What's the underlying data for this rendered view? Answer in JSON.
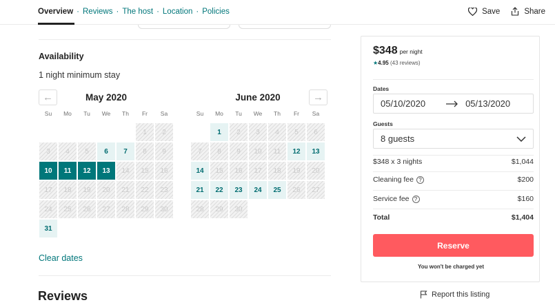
{
  "nav": {
    "links": [
      "Overview",
      "Reviews",
      "The host",
      "Location",
      "Policies"
    ],
    "separator": "·",
    "save_label": "Save",
    "share_label": "Share"
  },
  "availability": {
    "title": "Availability",
    "min_stay": "1 night minimum stay",
    "prev_icon": "←",
    "next_icon": "→",
    "clear_dates": "Clear dates",
    "months": [
      {
        "title": "May 2020",
        "dows": [
          "Su",
          "Mo",
          "Tu",
          "We",
          "Th",
          "Fr",
          "Sa"
        ],
        "offset": 5,
        "days": 31,
        "available": [
          6,
          7,
          31
        ],
        "selected": [
          10,
          11,
          12,
          13
        ]
      },
      {
        "title": "June 2020",
        "dows": [
          "Su",
          "Mo",
          "Tu",
          "We",
          "Th",
          "Fr",
          "Sa"
        ],
        "offset": 1,
        "days": 30,
        "available": [
          1,
          12,
          13,
          14,
          21,
          22,
          23,
          24,
          25
        ],
        "selected": []
      }
    ]
  },
  "reviews_heading": "Reviews",
  "booking": {
    "price": "$348",
    "price_unit": "per night",
    "rating_star": "★",
    "rating": "4.95",
    "reviews_count": "(43 reviews)",
    "dates_label": "Dates",
    "checkin": "05/10/2020",
    "checkout": "05/13/2020",
    "guests_label": "Guests",
    "guests": "8 guests",
    "nights_label": "$348 x 3 nights",
    "nights_value": "$1,044",
    "cleaning_label": "Cleaning fee",
    "cleaning_value": "$200",
    "service_label": "Service fee",
    "service_value": "$160",
    "total_label": "Total",
    "total_value": "$1,404",
    "help_icon": "?",
    "reserve_label": "Reserve",
    "no_charge": "You won't be charged yet"
  },
  "report_label": "Report this listing",
  "colors": {
    "accent": "#00767a",
    "selected": "#00777a",
    "available": "#e6f3f3",
    "reserve": "#ff5a5f"
  }
}
